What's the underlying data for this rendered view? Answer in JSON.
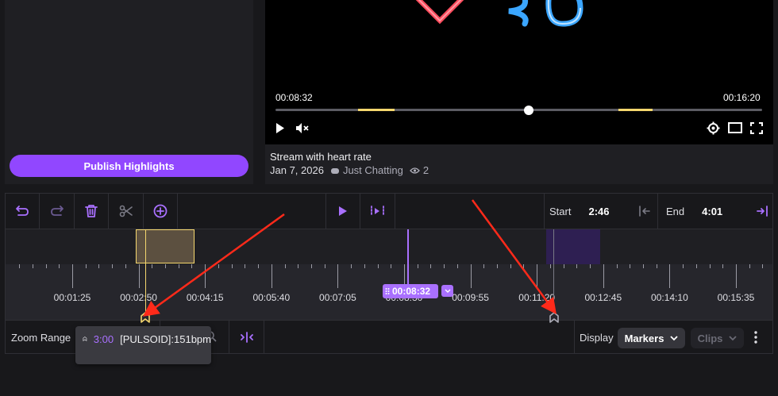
{
  "left_panel": {
    "publish_label": "Publish Highlights"
  },
  "player": {
    "current_time": "00:08:32",
    "duration": "00:16:20",
    "progress": 0.52,
    "highlight_ranges": [
      [
        0.17,
        0.245
      ],
      [
        0.705,
        0.775
      ]
    ],
    "overlay_number_fragment": "38",
    "controls": [
      "play-icon",
      "mute-icon",
      "settings-icon",
      "theater-mode-icon",
      "fullscreen-icon"
    ]
  },
  "stream": {
    "title": "Stream with heart rate",
    "date": "Jan 7, 2026",
    "category": "Just Chatting",
    "views": "2"
  },
  "toolbar": {
    "tools": [
      "undo-icon",
      "redo-icon",
      "delete-icon",
      "cut-icon",
      "add-icon",
      "play-icon",
      "play-selection-icon"
    ],
    "start_label": "Start",
    "start_value": "2:46",
    "end_label": "End",
    "end_value": "4:01"
  },
  "ruler": {
    "labels": [
      "00:01:25",
      "00:02:50",
      "00:04:15",
      "00:05:40",
      "00:07:05",
      "00:08:30",
      "00:09:55",
      "00:11:20",
      "00:12:45",
      "00:14:10",
      "00:15:35"
    ],
    "playhead_time": "00:08:32"
  },
  "marker_tooltip": {
    "time": "3:00",
    "text": "[PULSOID]:151bpm"
  },
  "bottom_bar": {
    "zoom_label": "Zoom Range",
    "display_label": "Display",
    "markers_label": "Markers",
    "clips_label": "Clips"
  },
  "colors": {
    "accent": "#9147ff",
    "clip_yellow": "#f5d76e",
    "arrow_red": "#ff2a1a"
  }
}
